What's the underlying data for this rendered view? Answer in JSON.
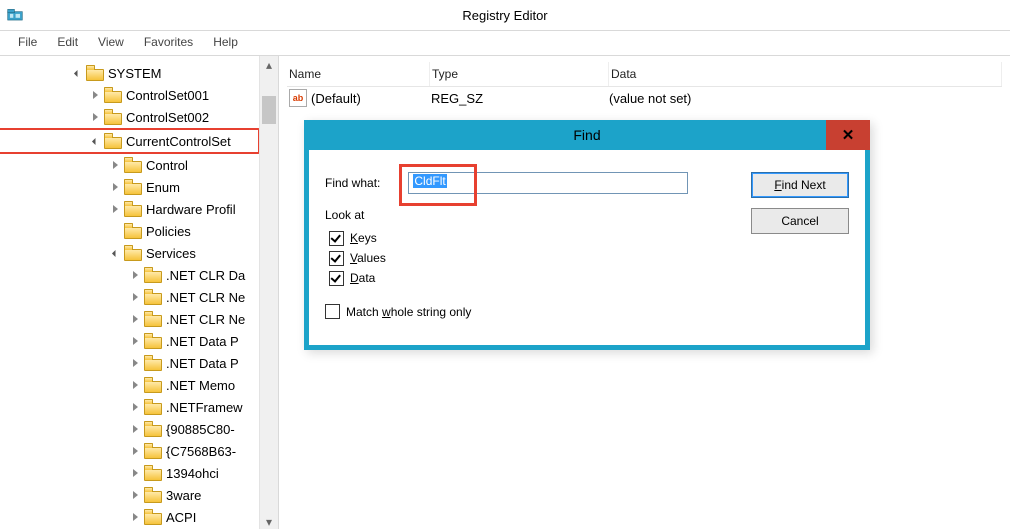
{
  "app": {
    "title": "Registry Editor"
  },
  "menu": {
    "file": "File",
    "edit": "Edit",
    "view": "View",
    "favorites": "Favorites",
    "help": "Help"
  },
  "tree": {
    "root": "SYSTEM",
    "cs001": "ControlSet001",
    "cs002": "ControlSet002",
    "ccs": "CurrentControlSet",
    "control": "Control",
    "enum": "Enum",
    "hwprofiles": "Hardware Profil",
    "policies": "Policies",
    "services": "Services",
    "svc": [
      ".NET CLR Da",
      ".NET CLR Ne",
      ".NET CLR Ne",
      ".NET Data P",
      ".NET Data P",
      ".NET Memo",
      ".NETFramew",
      "{90885C80-",
      "{C7568B63-",
      "1394ohci",
      "3ware",
      "ACPI"
    ]
  },
  "list": {
    "headers": {
      "name": "Name",
      "type": "Type",
      "data": "Data"
    },
    "rows": [
      {
        "icon": "ab",
        "name": "(Default)",
        "type": "REG_SZ",
        "data": "(value not set)"
      }
    ]
  },
  "find": {
    "title": "Find",
    "label": "Find what:",
    "value": "CldFlt",
    "lookat_label": "Look at",
    "keys_label": "Keys",
    "values_label": "Values",
    "data_label": "Data",
    "keys_checked": true,
    "values_checked": true,
    "data_checked": true,
    "match_label": "Match whole string only",
    "match_checked": false,
    "findnext": "Find Next",
    "cancel": "Cancel"
  }
}
